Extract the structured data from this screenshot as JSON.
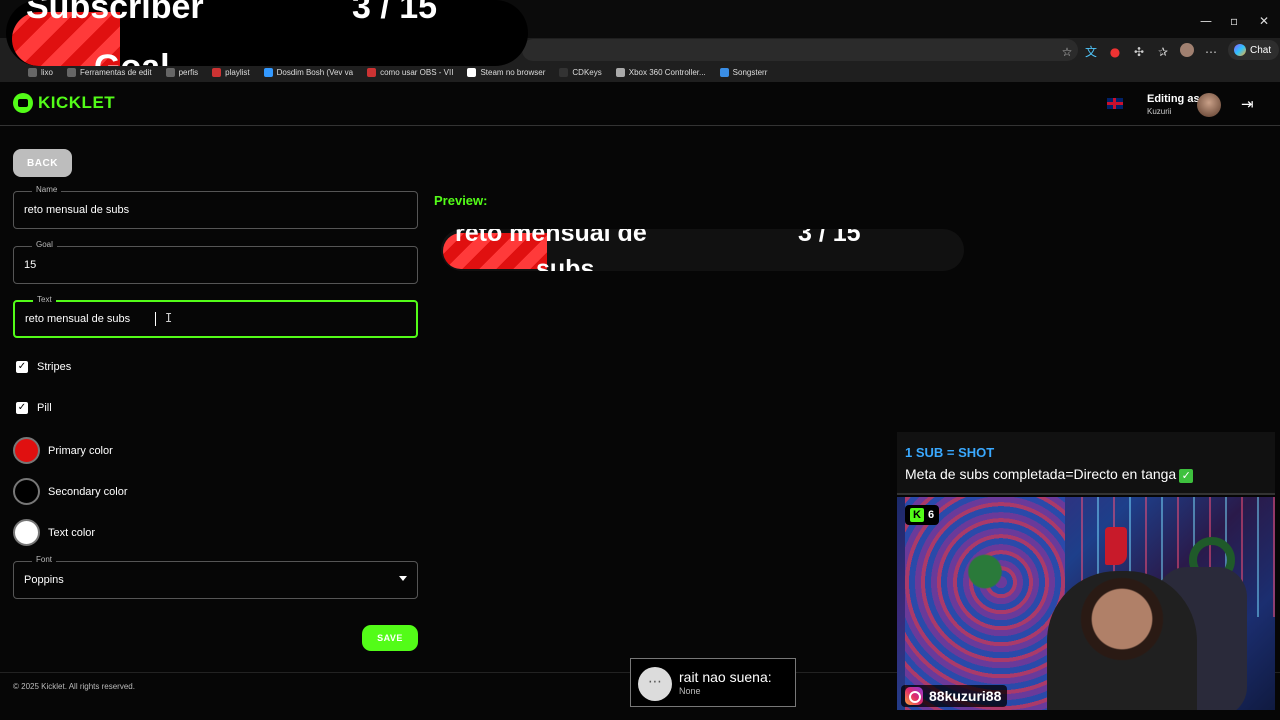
{
  "browser": {
    "omnibox_icons": [
      "star-icon",
      "translate-icon",
      "extension-icon",
      "puzzle-icon",
      "favorites-icon",
      "profile-icon",
      "more-icon"
    ],
    "chat_label": "Chat",
    "bookmarks": [
      "lixo",
      "Ferramentas de edit",
      "perfis",
      "playlist",
      "Dosdim Bosh (Vev va",
      "como usar OBS - VII",
      "Steam no browser",
      "CDKeys",
      "Xbox 360 Controller...",
      "Songsterr"
    ]
  },
  "stream_overlay": {
    "top_left_text": "Subscriber",
    "top_left_count": "3 / 15",
    "top_left_goal": "Goal",
    "goal_title": "1 SUB = SHOT",
    "goal_text": "Meta de subs completada=Directo en tanga",
    "kick_viewers": "6",
    "instagram_handle": "88kuzuri88",
    "toast_title": "rait nao suena:",
    "toast_sub": "None"
  },
  "header": {
    "logo": "KICKLET",
    "editing_as": "Editing as",
    "user": "Kuzurii"
  },
  "form": {
    "back_label": "BACK",
    "name_label": "Name",
    "name_value": "reto mensual de subs",
    "goal_label": "Goal",
    "goal_value": "15",
    "text_label": "Text",
    "text_value": "reto mensual de subs",
    "stripes_label": "Stripes",
    "pill_label": "Pill",
    "primary_color_label": "Primary color",
    "secondary_color_label": "Secondary color",
    "text_color_label": "Text color",
    "font_label": "Font",
    "font_value": "Poppins",
    "save_label": "SAVE"
  },
  "colors": {
    "primary": "#e01010",
    "secondary": "#000000",
    "text": "#ffffff",
    "accent": "#53fc18"
  },
  "preview": {
    "label": "Preview:",
    "line1": "reto mensual de",
    "line2": "subs",
    "count": "3 / 15",
    "progress_fraction": 0.2
  },
  "footer": {
    "copyright": "© 2025 Kicklet. All rights reserved."
  }
}
